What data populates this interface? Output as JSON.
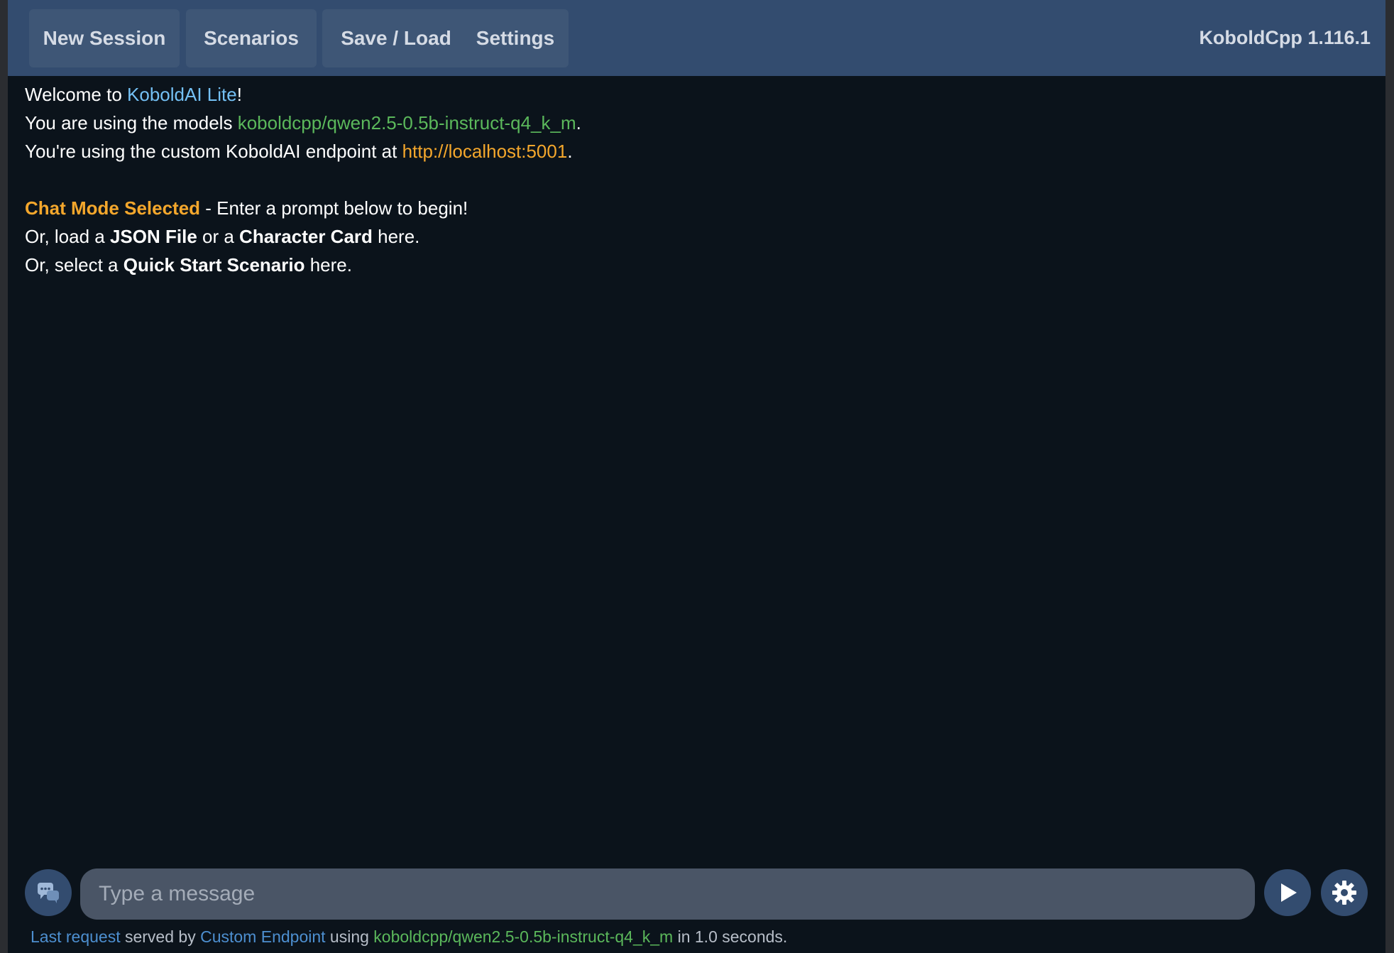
{
  "nav": {
    "buttons": [
      "New Session",
      "Scenarios",
      "Save / Load",
      "Settings"
    ],
    "version": "KoboldCpp 1.116.1"
  },
  "intro": {
    "welcome_prefix": "Welcome to ",
    "welcome_link": "KoboldAI Lite",
    "welcome_suffix": "!",
    "models_prefix": "You are using the models ",
    "models_value": "koboldcpp/qwen2.5-0.5b-instruct-q4_k_m",
    "models_suffix": ".",
    "endpoint_prefix": "You're using the custom KoboldAI endpoint at ",
    "endpoint_url": "http://localhost:5001",
    "endpoint_suffix": ".",
    "chat_mode_label": "Chat Mode Selected",
    "chat_mode_rest": " - Enter a prompt below to begin!",
    "load_prefix": "Or, load a ",
    "load_json": "JSON File",
    "load_mid": " or a ",
    "load_card": "Character Card",
    "load_suffix": " here.",
    "scenario_prefix": "Or, select a ",
    "scenario_link": "Quick Start Scenario",
    "scenario_suffix": " here."
  },
  "input": {
    "placeholder": "Type a message",
    "value": ""
  },
  "icons": {
    "chat_toggle": "chat-bubbles-icon",
    "send": "play-send-icon",
    "settings": "gear-icon"
  },
  "status": {
    "last_request": "Last request",
    "served_by": " served by ",
    "endpoint": "Custom Endpoint",
    "using": " using ",
    "model": "koboldcpp/qwen2.5-0.5b-instruct-q4_k_m",
    "time_text": " in 1.0 seconds."
  },
  "colors": {
    "topbar": "#334c6f",
    "background": "#0b131b",
    "link_blue": "#74c0f4",
    "model_green": "#5bb85b",
    "accent_orange": "#f4a72c"
  }
}
